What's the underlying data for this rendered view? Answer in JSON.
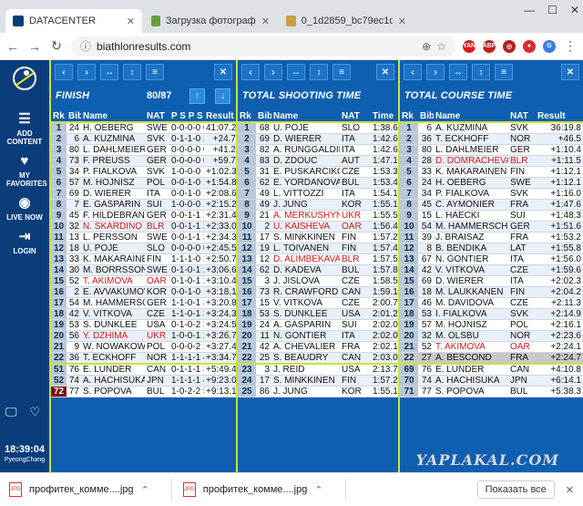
{
  "browser": {
    "tabs": [
      {
        "title": "DATACENTER",
        "active": true
      },
      {
        "title": "Загрузка фотографий н",
        "active": false
      },
      {
        "title": "0_1d2859_bc79ec1d_orig",
        "active": false
      }
    ],
    "url": "biathlonresults.com"
  },
  "sidebar": {
    "items": [
      "ADD CONTENT",
      "MY FAVORITES",
      "LIVE NOW",
      "LOGIN"
    ],
    "time": "18:39:04",
    "location": "PyeongChang"
  },
  "panels": {
    "finish": {
      "title": "FINISH",
      "count": "80/87",
      "headers": [
        "Rk",
        "Bib",
        "Name",
        "NAT",
        "P S P S T",
        "Result"
      ],
      "rows": [
        [
          "1",
          "24",
          "H. OEBERG",
          "SWE",
          "0-0-0-0 0",
          "41:07.2",
          ""
        ],
        [
          "2",
          "6",
          "A. KUZMINA",
          "SVK",
          "0-1-1-0 2",
          "+24.7",
          ""
        ],
        [
          "3",
          "80",
          "L. DAHLMEIER",
          "GER",
          "0-0-0-0 0",
          "+41.2",
          ""
        ],
        [
          "4",
          "73",
          "F. PREUSS",
          "GER",
          "0-0-0-0 0",
          "+59.7",
          ""
        ],
        [
          "5",
          "34",
          "P. FIALKOVA",
          "SVK",
          "1-0-0-0 1",
          "+1:02.3",
          ""
        ],
        [
          "6",
          "57",
          "M. HOJNISZ",
          "POL",
          "0-0-1-0 1",
          "+1:54.8",
          ""
        ],
        [
          "7",
          "69",
          "D. WIERER",
          "ITA",
          "0-0-1-0 1",
          "+2:08.6",
          ""
        ],
        [
          "8",
          "7",
          "E. GASPARIN",
          "SUI",
          "1-0-0-0 1",
          "+2:15.2",
          ""
        ],
        [
          "9",
          "45",
          "F. HILDEBRAND",
          "GER",
          "0-0-1-1 2",
          "+2:31.4",
          ""
        ],
        [
          "10",
          "32",
          "N. SKARDINO",
          "BLR",
          "0-0-1-1 2",
          "+2:33.0",
          "red"
        ],
        [
          "11",
          "13",
          "L. PERSSON",
          "SWE",
          "0-0-1-1 2",
          "+2:34.3",
          ""
        ],
        [
          "12",
          "18",
          "U. POJE",
          "SLO",
          "0-0-0-0 0",
          "+2:45.5",
          ""
        ],
        [
          "13",
          "33",
          "K. MAKARAINEN",
          "FIN",
          "1-1-1-0 3",
          "+2:50.7",
          ""
        ],
        [
          "14",
          "30",
          "M. BORRSSON",
          "SWE",
          "0-1-0-1 2",
          "+3:06.6",
          ""
        ],
        [
          "15",
          "52",
          "T. AKIMOVA",
          "OAR",
          "0-1-0-1 2",
          "+3:10.4",
          "red"
        ],
        [
          "16",
          "2",
          "E. AVVAKUMOVA",
          "KOR",
          "0-0-1-0 1",
          "+3:18.1",
          ""
        ],
        [
          "17",
          "54",
          "M. HAMMERSCHMIDT",
          "GER",
          "1-1-0-1 3",
          "+3:20.8",
          ""
        ],
        [
          "18",
          "42",
          "V. VITKOVA",
          "CZE",
          "1-1-0-1 3",
          "+3:24.3",
          ""
        ],
        [
          "19",
          "53",
          "S. DUNKLEE",
          "USA",
          "0-1-0-2 3",
          "+3:24.5",
          ""
        ],
        [
          "20",
          "56",
          "Y. DZHIMA",
          "UKR",
          "1-0-0-1 2",
          "+3:26.7",
          "red"
        ],
        [
          "21",
          "9",
          "W. NOWAKOWSKA",
          "POL",
          "0-0-0-2 2",
          "+3:27.4",
          ""
        ],
        [
          "22",
          "36",
          "T. ECKHOFF",
          "NOR",
          "1-1-1-1 4",
          "+3:34.7",
          ""
        ],
        [
          "51",
          "76",
          "E. LUNDER",
          "CAN",
          "0-1-1-1 3",
          "+5:49.4",
          "sep"
        ],
        [
          "52",
          "74",
          "A. HACHISUKA",
          "JPN",
          "1-1-1-1 4",
          "+9:23.0",
          ""
        ],
        [
          "72",
          "77",
          "S. POPOVA",
          "BUL",
          "1-0-2-2 5",
          "+9:13.1",
          "dark"
        ]
      ]
    },
    "shooting": {
      "title": "TOTAL SHOOTING TIME",
      "headers": [
        "Rk",
        "Bib",
        "Name",
        "NAT",
        "Time"
      ],
      "rows": [
        [
          "1",
          "68",
          "U. POJE",
          "SLO",
          "1:38.6",
          ""
        ],
        [
          "2",
          "69",
          "D. WIERER",
          "ITA",
          "1:42.6",
          ""
        ],
        [
          "3",
          "82",
          "A. RUNGGALDIER",
          "ITA",
          "1:42.6",
          ""
        ],
        [
          "4",
          "83",
          "D. ZDOUC",
          "AUT",
          "1:47.1",
          ""
        ],
        [
          "5",
          "31",
          "E. PUSKARCIKOVA",
          "CZE",
          "1:53.3",
          ""
        ],
        [
          "6",
          "62",
          "E. YORDANOVA",
          "BUL",
          "1:53.4",
          ""
        ],
        [
          "7",
          "49",
          "L. VITTOZZI",
          "ITA",
          "1:54.1",
          ""
        ],
        [
          "8",
          "49",
          "J. JUNG",
          "KOR",
          "1:55.1",
          ""
        ],
        [
          "9",
          "21",
          "A. MERKUSHYNA",
          "UKR",
          "1:55.5",
          "red"
        ],
        [
          "10",
          "2",
          "U. KAISHEVA",
          "OAR",
          "1:56.4",
          "red"
        ],
        [
          "11",
          "17",
          "S. MINKKINEN",
          "FIN",
          "1:57.2",
          ""
        ],
        [
          "12",
          "19",
          "L. TOIVANEN",
          "FIN",
          "1:57.4",
          ""
        ],
        [
          "13",
          "12",
          "D. ALIMBEKAVA",
          "BLR",
          "1:57.5",
          "red"
        ],
        [
          "14",
          "62",
          "D. KADEVA",
          "BUL",
          "1:57.8",
          ""
        ],
        [
          "15",
          "3",
          "J. JISLOVA",
          "CZE",
          "1:58.5",
          ""
        ],
        [
          "16",
          "73",
          "R. CRAWFORD",
          "CAN",
          "1:59.1",
          ""
        ],
        [
          "17",
          "15",
          "V. VITKOVA",
          "CZE",
          "2:00.7",
          ""
        ],
        [
          "18",
          "53",
          "S. DUNKLEE",
          "USA",
          "2:01.2",
          ""
        ],
        [
          "19",
          "24",
          "A. GASPARIN",
          "SUI",
          "2:02.0",
          ""
        ],
        [
          "20",
          "11",
          "N. GONTIER",
          "ITA",
          "2:02.0",
          ""
        ],
        [
          "21",
          "42",
          "A. CHEVALIER",
          "FRA",
          "2:02.1",
          ""
        ],
        [
          "22",
          "25",
          "S. BEAUDRY",
          "CAN",
          "2:03.0",
          ""
        ],
        [
          "23",
          "3",
          "J. REID",
          "USA",
          "2:13.7",
          "sep"
        ],
        [
          "24",
          "17",
          "S. MINKKINEN",
          "FIN",
          "1:57.2",
          ""
        ],
        [
          "25",
          "86",
          "J. JUNG",
          "KOR",
          "1:55.1",
          ""
        ]
      ]
    },
    "course": {
      "title": "TOTAL COURSE TIME",
      "headers": [
        "Rk",
        "Bib",
        "Name",
        "NAT",
        "Result"
      ],
      "rows": [
        [
          "1",
          "6",
          "A. KUZMINA",
          "SVK",
          "36:19.8",
          ""
        ],
        [
          "2",
          "36",
          "T. ECKHOFF",
          "NOR",
          "+46.5",
          ""
        ],
        [
          "3",
          "80",
          "L. DAHLMEIER",
          "GER",
          "+1:10.4",
          ""
        ],
        [
          "4",
          "28",
          "D. DOMRACHEVA",
          "BLR",
          "+1:11.5",
          "red"
        ],
        [
          "5",
          "33",
          "K. MAKARAINEN",
          "FIN",
          "+1:12.1",
          ""
        ],
        [
          "6",
          "24",
          "H. OEBERG",
          "SWE",
          "+1:12.1",
          ""
        ],
        [
          "7",
          "34",
          "P. FIALKOVA",
          "SVK",
          "+1:16.0",
          ""
        ],
        [
          "8",
          "45",
          "C. AYMONIER",
          "FRA",
          "+1:47.6",
          ""
        ],
        [
          "9",
          "15",
          "L. HAECKI",
          "SUI",
          "+1:48.3",
          ""
        ],
        [
          "10",
          "54",
          "M. HAMMERSCHMIDT",
          "GER",
          "+1:51.6",
          ""
        ],
        [
          "11",
          "39",
          "J. BRAISAZ",
          "FRA",
          "+1:53.2",
          ""
        ],
        [
          "12",
          "8",
          "B. BENDIKA",
          "LAT",
          "+1:55.8",
          ""
        ],
        [
          "13",
          "67",
          "N. GONTIER",
          "ITA",
          "+1:56.0",
          ""
        ],
        [
          "14",
          "42",
          "V. VITKOVA",
          "CZE",
          "+1:59.6",
          ""
        ],
        [
          "15",
          "69",
          "D. WIERER",
          "ITA",
          "+2:02.3",
          ""
        ],
        [
          "16",
          "18",
          "M. LAUKKANEN",
          "FIN",
          "+2:04.2",
          ""
        ],
        [
          "17",
          "46",
          "M. DAVIDOVA",
          "CZE",
          "+2:11.3",
          ""
        ],
        [
          "18",
          "53",
          "I. FIALKOVA",
          "SVK",
          "+2:14.9",
          ""
        ],
        [
          "19",
          "57",
          "M. HOJNISZ",
          "POL",
          "+2:16.1",
          ""
        ],
        [
          "20",
          "32",
          "M. OLSBU",
          "NOR",
          "+2:23.6",
          ""
        ],
        [
          "21",
          "52",
          "T. AKIMOVA",
          "OAR",
          "+2:24.1",
          "red"
        ],
        [
          "22",
          "27",
          "A. BESCOND",
          "FRA",
          "+2:24.7",
          "hl"
        ],
        [
          "69",
          "76",
          "E. LUNDER",
          "CAN",
          "+4:10.8",
          "sep"
        ],
        [
          "70",
          "74",
          "A. HACHISUKA",
          "JPN",
          "+6:14.1",
          ""
        ],
        [
          "71",
          "77",
          "S. POPOVA",
          "BUL",
          "+5:38.3",
          ""
        ]
      ]
    }
  },
  "downloads": {
    "files": [
      "профитек_комме....jpg",
      "профитек_комме....jpg"
    ],
    "show_all": "Показать все"
  },
  "watermark": "YAPLAKAL.COM"
}
